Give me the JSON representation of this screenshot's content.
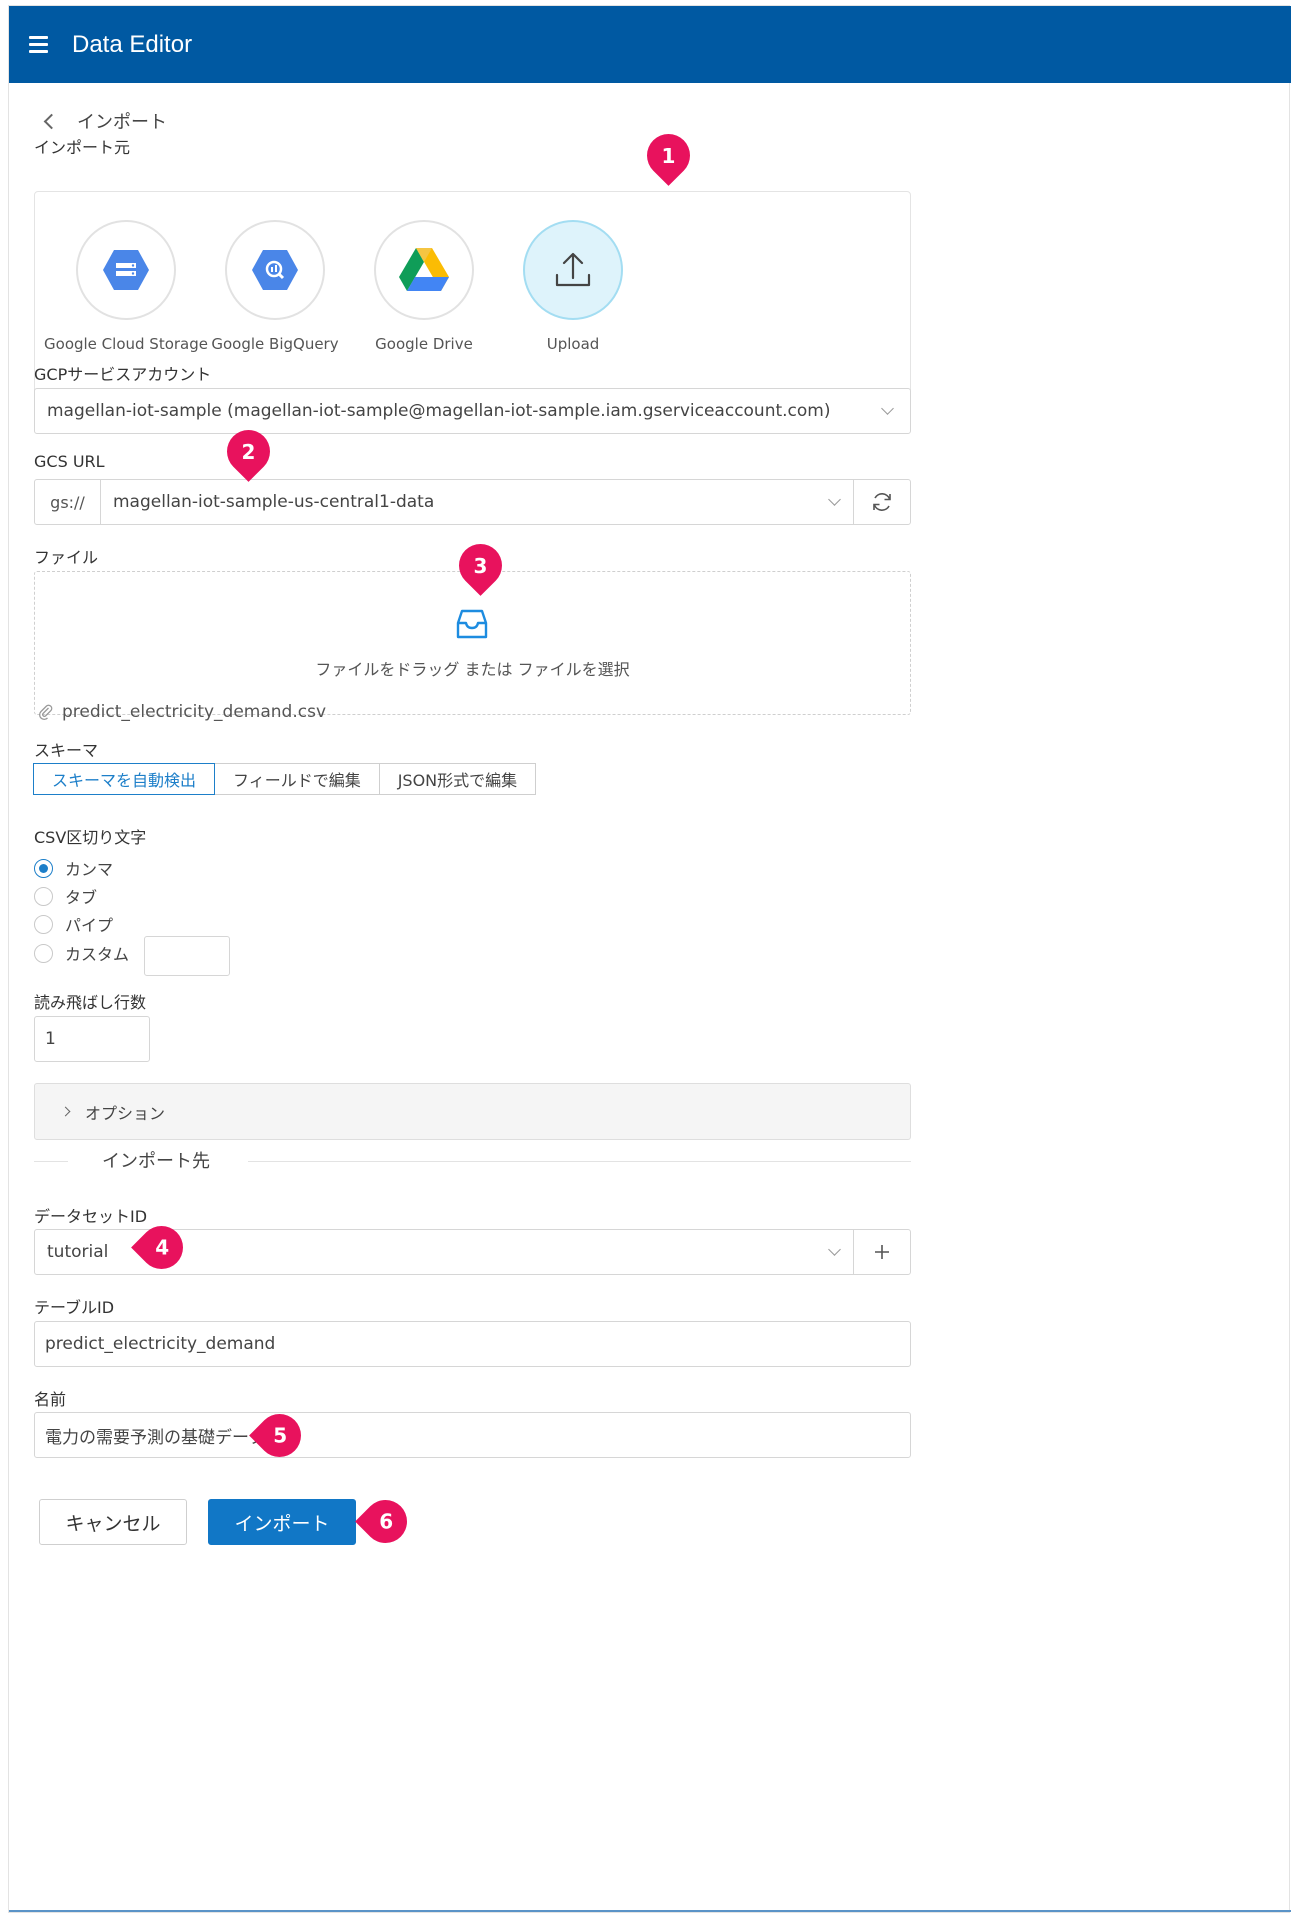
{
  "app": {
    "title": "Data Editor"
  },
  "page": {
    "back_label": "インポート"
  },
  "source": {
    "label": "インポート元",
    "options": [
      {
        "name": "Google Cloud Storage",
        "icon": "gcs-icon",
        "selected": false
      },
      {
        "name": "Google BigQuery",
        "icon": "bigquery-icon",
        "selected": false
      },
      {
        "name": "Google Drive",
        "icon": "drive-icon",
        "selected": false
      },
      {
        "name": "Upload",
        "icon": "upload-icon",
        "selected": true
      }
    ]
  },
  "service_account": {
    "label": "GCPサービスアカウント",
    "value": "magellan-iot-sample (magellan-iot-sample@magellan-iot-sample.iam.gserviceaccount.com)"
  },
  "gcs_url": {
    "label": "GCS URL",
    "prefix": "gs://",
    "value": "magellan-iot-sample-us-central1-data"
  },
  "file": {
    "label": "ファイル",
    "drop_text": "ファイルをドラッグ または ファイルを選択",
    "attached": "predict_electricity_demand.csv"
  },
  "schema": {
    "label": "スキーマ",
    "tabs": [
      "スキーマを自動検出",
      "フィールドで編集",
      "JSON形式で編集"
    ],
    "active_tab": 0
  },
  "csv": {
    "label": "CSV区切り文字",
    "options": [
      "カンマ",
      "タブ",
      "パイプ",
      "カスタム"
    ],
    "selected": 0,
    "custom_value": ""
  },
  "skip_rows": {
    "label": "読み飛ばし行数",
    "value": "1"
  },
  "options_panel": {
    "label": "オプション"
  },
  "destination": {
    "title": "インポート先",
    "dataset_label": "データセットID",
    "dataset_value": "tutorial",
    "table_label": "テーブルID",
    "table_value": "predict_electricity_demand",
    "name_label": "名前",
    "name_value": "電力の需要予測の基礎データ"
  },
  "buttons": {
    "cancel": "キャンセル",
    "import": "インポート"
  },
  "callouts": [
    "1",
    "2",
    "3",
    "4",
    "5",
    "6"
  ],
  "colors": {
    "appbar": "#0059a2",
    "primary": "#1177c6",
    "callout": "#e8125d",
    "selected_source": "#def3fb"
  }
}
